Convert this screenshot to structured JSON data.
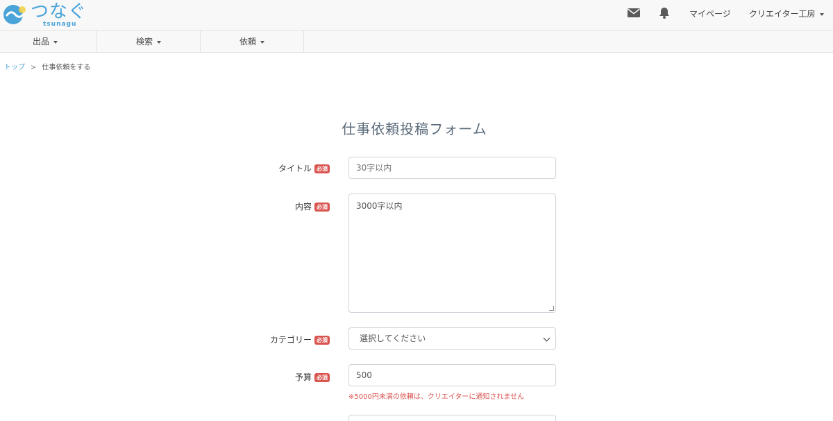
{
  "brand": {
    "name": "つなぐ",
    "sub": "tsunagu"
  },
  "header": {
    "mypage": "マイページ",
    "creator_menu": "クリエイター工房",
    "icons": [
      "envelope-icon",
      "bell-icon"
    ]
  },
  "menu": [
    {
      "label": "出品"
    },
    {
      "label": "検索"
    },
    {
      "label": "依頼"
    }
  ],
  "breadcrumb": {
    "home": "トップ",
    "separator": ">",
    "current": "仕事依頼をする"
  },
  "form": {
    "title": "仕事依頼投稿フォーム",
    "required_badge": "必須",
    "title_field": {
      "label": "タイトル",
      "placeholder": "30字以内"
    },
    "content_field": {
      "label": "内容",
      "placeholder": "3000字以内"
    },
    "category_field": {
      "label": "カテゴリー",
      "value": "選択してください"
    },
    "budget_field": {
      "label": "予算",
      "value": "500",
      "note": "※5000円未満の依頼は、クリエイターに通知されません"
    }
  },
  "colors": {
    "accent": "#4aa3d9",
    "required": "#d9534f",
    "title": "#5b6b7b"
  }
}
